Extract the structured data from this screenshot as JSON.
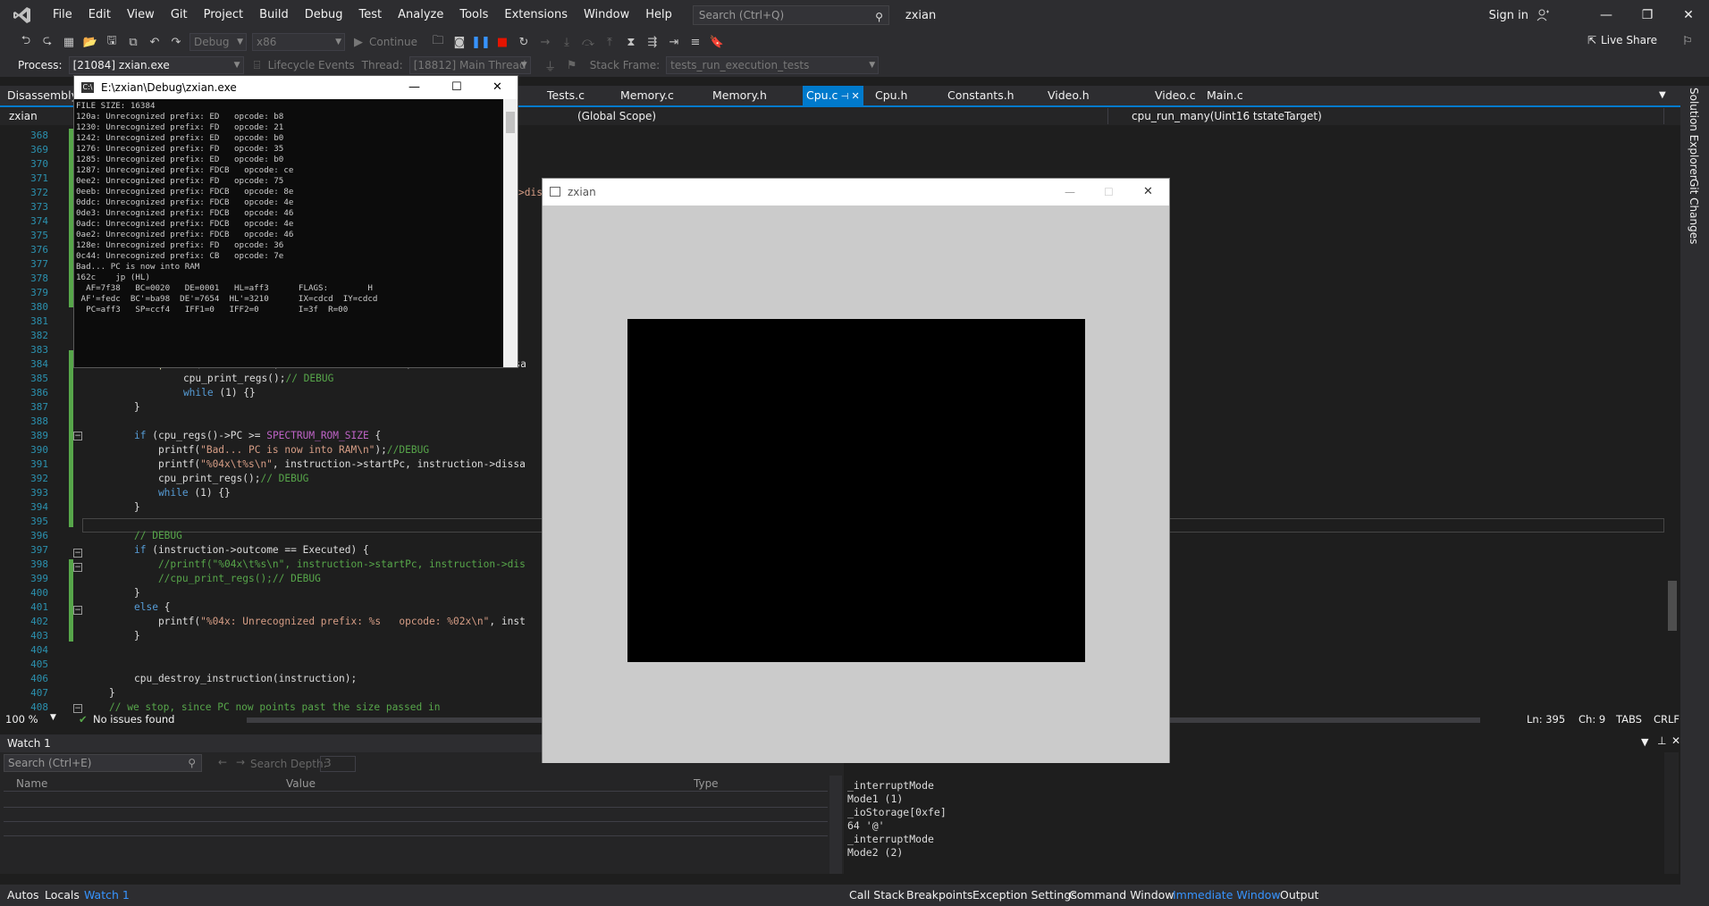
{
  "menubar": {
    "items": [
      "File",
      "Edit",
      "View",
      "Git",
      "Project",
      "Build",
      "Debug",
      "Test",
      "Analyze",
      "Tools",
      "Extensions",
      "Window",
      "Help"
    ],
    "search_placeholder": "Search (Ctrl+Q)",
    "solution_name": "zxian",
    "sign_in": "Sign in"
  },
  "toolbar": {
    "config": "Debug",
    "platform": "x86",
    "continue": "Continue",
    "live_share": "Live Share"
  },
  "debugbar": {
    "process_label": "Process:",
    "process_value": "[21084] zxian.exe",
    "lifecycle": "Lifecycle Events",
    "thread_label": "Thread:",
    "thread_value": "[18812] Main Thread",
    "stack_label": "Stack Frame:",
    "stack_value": "tests_run_execution_tests"
  },
  "tabs": {
    "disassembly": "Disassembly",
    "items": [
      "Tests.c",
      "Memory.c",
      "Memory.h",
      "Cpu.c",
      "Cpu.h",
      "Constants.h",
      "Video.h",
      "Video.c",
      "Main.c"
    ]
  },
  "navbar": {
    "project": "zxian",
    "scope": "(Global Scope)",
    "function": "cpu_run_many(Uint16 tstateTarget)"
  },
  "editor": {
    "line_numbers": [
      "368",
      "369",
      "370",
      "371",
      "372",
      "373",
      "374",
      "375",
      "376",
      "377",
      "378",
      "379",
      "380",
      "381",
      "382",
      "383",
      "384",
      "385",
      "386",
      "387",
      "388",
      "389",
      "390",
      "391",
      "392",
      "393",
      "394",
      "395",
      "396",
      "397",
      "398",
      "399",
      "400",
      "401",
      "402",
      "403",
      "404",
      "405",
      "406",
      "407",
      "408"
    ],
    "lines": [
      {
        "n": 384,
        "parts": [
          [
            "fn",
            "printf"
          ],
          [
            "",
            "(\"%04x\\t%s\\n\", instruction->startPc, instruction->dissa"
          ]
        ]
      },
      {
        "n": 385,
        "parts": [
          [
            "",
            "    cpu_print_regs();"
          ],
          [
            "cmt",
            "// DEBUG"
          ]
        ]
      },
      {
        "n": 386,
        "parts": [
          [
            "kw",
            "    while"
          ],
          [
            "",
            " (1) {}"
          ]
        ]
      },
      {
        "n": 387,
        "parts": [
          [
            "",
            "}"
          ]
        ]
      },
      {
        "n": 389,
        "parts": [
          [
            "kw",
            "if"
          ],
          [
            "",
            " (cpu_regs()->PC >= "
          ],
          [
            "mac",
            "SPECTRUM_ROM_SIZE"
          ],
          [
            "",
            " {"
          ]
        ]
      },
      {
        "n": 390,
        "parts": [
          [
            "",
            "    printf("
          ],
          [
            "str",
            "\"Bad... PC is now into RAM\\n\""
          ],
          [
            "",
            ");"
          ],
          [
            "cmt",
            "//DEBUG"
          ]
        ]
      },
      {
        "n": 391,
        "parts": [
          [
            "",
            "    printf("
          ],
          [
            "str",
            "\"%04x\\t%s\\n\""
          ],
          [
            "",
            ", instruction->startPc, instruction->dissa"
          ]
        ]
      },
      {
        "n": 392,
        "parts": [
          [
            "",
            "    cpu_print_regs();"
          ],
          [
            "cmt",
            "// DEBUG"
          ]
        ]
      },
      {
        "n": 393,
        "parts": [
          [
            "kw",
            "    while"
          ],
          [
            "",
            " (1) {}"
          ]
        ]
      },
      {
        "n": 394,
        "parts": [
          [
            "",
            "}"
          ]
        ]
      },
      {
        "n": 396,
        "parts": [
          [
            "cmt",
            "// DEBUG"
          ]
        ]
      },
      {
        "n": 397,
        "parts": [
          [
            "kw",
            "if"
          ],
          [
            "",
            " (instruction->outcome == Executed) {"
          ]
        ]
      },
      {
        "n": 398,
        "parts": [
          [
            "cmt",
            "    //printf(\"%04x\\t%s\\n\", instruction->startPc, instruction->dis"
          ]
        ]
      },
      {
        "n": 399,
        "parts": [
          [
            "cmt",
            "    //cpu_print_regs();// DEBUG"
          ]
        ]
      },
      {
        "n": 400,
        "parts": [
          [
            "",
            "}"
          ]
        ]
      },
      {
        "n": 401,
        "parts": [
          [
            "kw",
            "else"
          ],
          [
            "",
            " {"
          ]
        ]
      },
      {
        "n": 402,
        "parts": [
          [
            "",
            "    printf("
          ],
          [
            "str",
            "\"%04x: Unrecognized prefix: %s   opcode: %02x\\n\""
          ],
          [
            "",
            ", inst"
          ]
        ]
      },
      {
        "n": 403,
        "parts": [
          [
            "",
            "}"
          ]
        ]
      },
      {
        "n": 406,
        "parts": [
          [
            "",
            "cpu_destroy_instruction(instruction);"
          ]
        ]
      },
      {
        "n": 407,
        "parts": [
          [
            "",
            "}"
          ]
        ]
      },
      {
        "n": 408,
        "parts": [
          [
            "cmt",
            "// we stop, since PC now points past the size passed in"
          ]
        ]
      }
    ],
    "partial_line_372": ">dis"
  },
  "editor_status": {
    "zoom": "100 %",
    "issues": "No issues found",
    "ln": "Ln: 395",
    "ch": "Ch: 9",
    "tabs": "TABS",
    "eol": "CRLF"
  },
  "watch": {
    "title": "Watch 1",
    "search_placeholder": "Search (Ctrl+E)",
    "search_depth_label": "Search Depth:",
    "search_depth": "3",
    "columns": [
      "Name",
      "Value",
      "Type"
    ]
  },
  "immediate": {
    "lines": [
      "_interruptMode",
      "Mode1 (1)",
      "_ioStorage[0xfe]",
      "64 '@'",
      "_interruptMode",
      "Mode2 (2)"
    ]
  },
  "bottom_tabs_left": [
    "Autos",
    "Locals",
    "Watch 1"
  ],
  "bottom_tabs_right": [
    "Call Stack",
    "Breakpoints",
    "Exception Settings",
    "Command Window",
    "Immediate Window",
    "Output"
  ],
  "sidebar": [
    "Solution Explorer",
    "Git Changes"
  ],
  "console": {
    "title": "E:\\zxian\\Debug\\zxian.exe",
    "lines": [
      "FILE SIZE: 16384",
      "120a: Unrecognized prefix: ED   opcode: b8",
      "1230: Unrecognized prefix: FD   opcode: 21",
      "1242: Unrecognized prefix: ED   opcode: b0",
      "1276: Unrecognized prefix: FD   opcode: 35",
      "1285: Unrecognized prefix: ED   opcode: b0",
      "1287: Unrecognized prefix: FDCB   opcode: ce",
      "0ee2: Unrecognized prefix: FD   opcode: 75",
      "0eeb: Unrecognized prefix: FDCB   opcode: 8e",
      "0ddc: Unrecognized prefix: FDCB   opcode: 4e",
      "0de3: Unrecognized prefix: FDCB   opcode: 46",
      "0adc: Unrecognized prefix: FDCB   opcode: 4e",
      "0ae2: Unrecognized prefix: FDCB   opcode: 46",
      "128e: Unrecognized prefix: FD   opcode: 36",
      "0c44: Unrecognized prefix: CB   opcode: 7e",
      "Bad... PC is now into RAM",
      "162c    jp (HL)",
      "  AF=7f38   BC=0020   DE=0001   HL=aff3      FLAGS:        H",
      " AF'=fedc  BC'=ba98  DE'=7654  HL'=3210      IX=cdcd  IY=cdcd",
      "  PC=aff3   SP=ccf4   IFF1=0   IFF2=0        I=3f  R=00"
    ]
  },
  "sdl_window": {
    "title": "zxian"
  }
}
